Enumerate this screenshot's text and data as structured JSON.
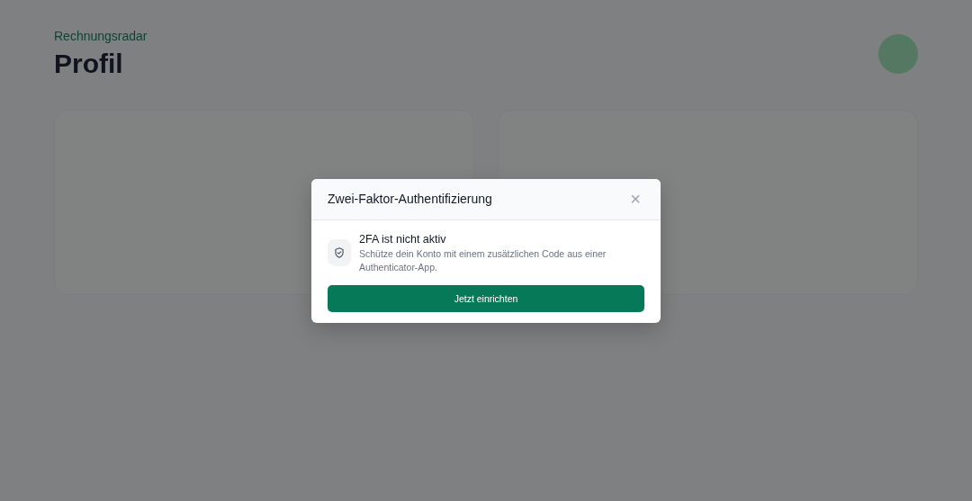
{
  "header": {
    "brand": "Rechnungsradar",
    "title": "Profil"
  },
  "dialog": {
    "title": "Zwei-Faktor-Authentifizierung",
    "close": "×",
    "status_title": "2FA ist nicht aktiv",
    "status_text": "Schütze dein Konto mit einem zusätzlichen Code aus einer Authenticator-App.",
    "button": "Jetzt einrichten"
  }
}
